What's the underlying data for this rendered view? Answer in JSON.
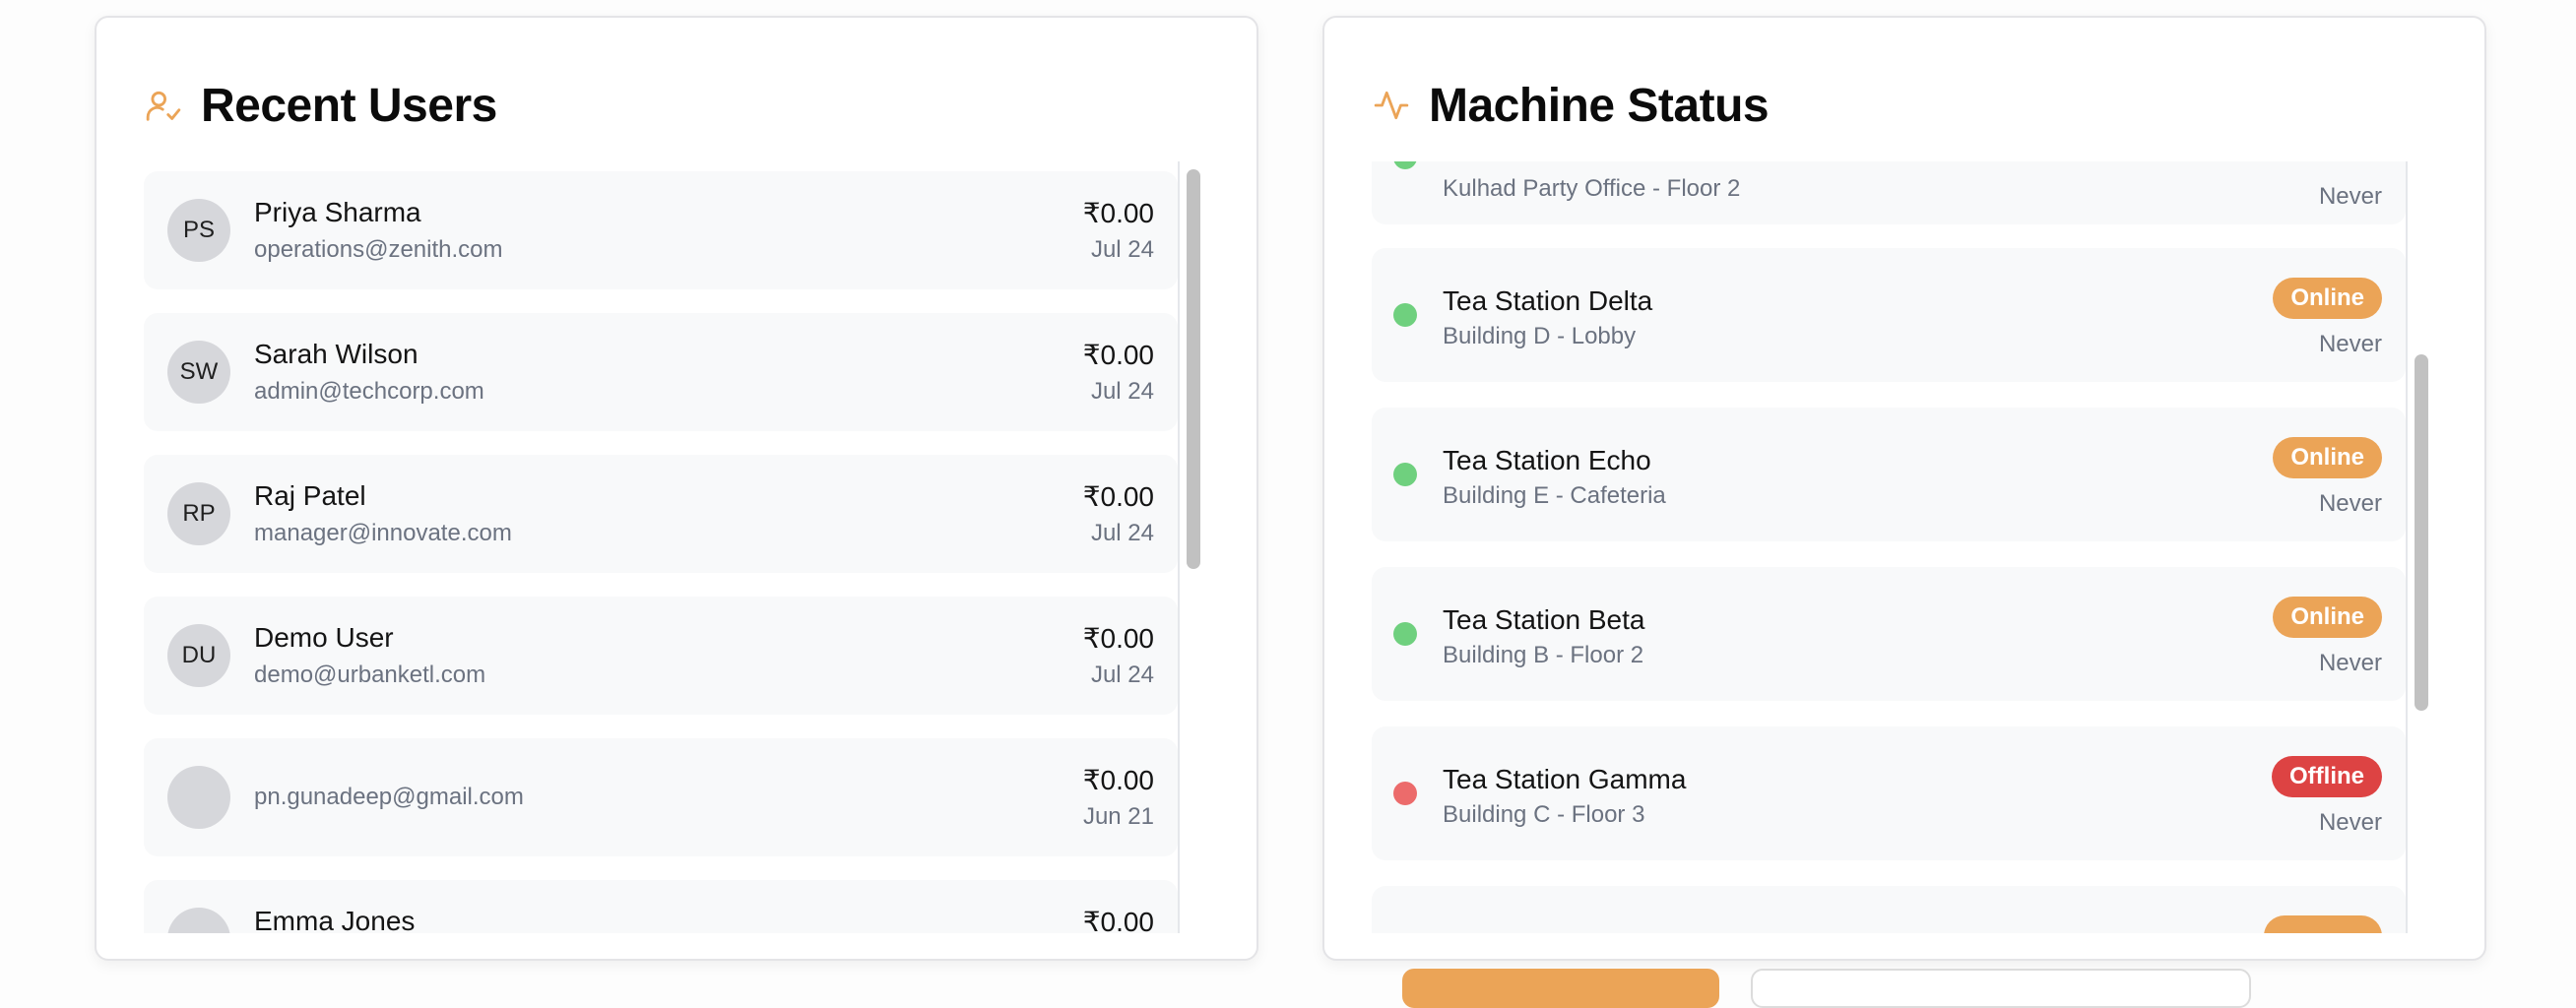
{
  "recent_users": {
    "title": "Recent Users",
    "icon": "user-check-icon",
    "users": [
      {
        "initials": "PS",
        "name": "Priya Sharma",
        "email": "operations@zenith.com",
        "amount": "₹0.00",
        "date": "Jul 24"
      },
      {
        "initials": "SW",
        "name": "Sarah Wilson",
        "email": "admin@techcorp.com",
        "amount": "₹0.00",
        "date": "Jul 24"
      },
      {
        "initials": "RP",
        "name": "Raj Patel",
        "email": "manager@innovate.com",
        "amount": "₹0.00",
        "date": "Jul 24"
      },
      {
        "initials": "DU",
        "name": "Demo User",
        "email": "demo@urbanketl.com",
        "amount": "₹0.00",
        "date": "Jul 24"
      },
      {
        "initials": "",
        "name": "",
        "email": "pn.gunadeep@gmail.com",
        "amount": "₹0.00",
        "date": "Jun 21"
      },
      {
        "initials": "",
        "name": "Emma Jones",
        "email": "",
        "amount": "₹0.00",
        "date": ""
      }
    ]
  },
  "machine_status": {
    "title": "Machine Status",
    "icon": "activity-icon",
    "machines": [
      {
        "name": "",
        "location": "Kulhad Party Office - Floor 2",
        "status": "",
        "last_seen": "Never",
        "state": "online"
      },
      {
        "name": "Tea Station Delta",
        "location": "Building D - Lobby",
        "status": "Online",
        "last_seen": "Never",
        "state": "online"
      },
      {
        "name": "Tea Station Echo",
        "location": "Building E - Cafeteria",
        "status": "Online",
        "last_seen": "Never",
        "state": "online"
      },
      {
        "name": "Tea Station Beta",
        "location": "Building B - Floor 2",
        "status": "Online",
        "last_seen": "Never",
        "state": "online"
      },
      {
        "name": "Tea Station Gamma",
        "location": "Building C - Floor 3",
        "status": "Offline",
        "last_seen": "Never",
        "state": "offline"
      },
      {
        "name": "",
        "location": "",
        "status": "",
        "last_seen": "",
        "state": "online"
      }
    ]
  },
  "colors": {
    "accent": "#eba457",
    "online_dot": "#6fd07e",
    "offline_dot": "#ec6b6b",
    "offline_badge": "#dd4343"
  }
}
